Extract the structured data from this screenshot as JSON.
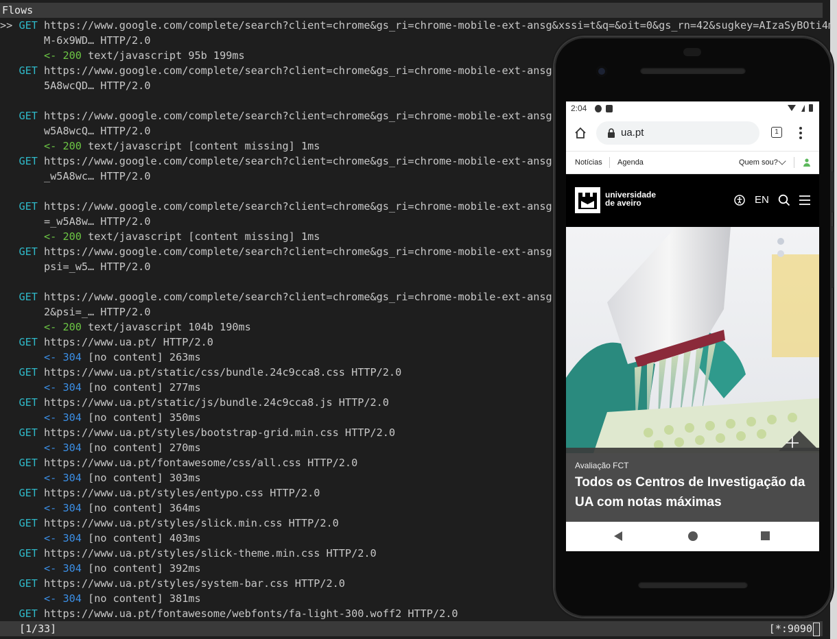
{
  "terminal": {
    "title": "Flows",
    "status_left": "[1/33]",
    "status_right": "[*:9090",
    "selection_marker": ">>",
    "flows": [
      {
        "req_line": "https://www.google.com/complete/search?client=chrome&gs_ri=chrome-mobile-ext-ansg&xssi=t&q=&oit=0&gs_rn=42&sugkey=AIzaSyBOti4m",
        "req_cont": "M-6x9WD… HTTP/2.0",
        "method": "GET",
        "resp": {
          "arrow": "<-",
          "code": "200",
          "text": "text/javascript 95b 199ms"
        }
      },
      {
        "req_line": "https://www.google.com/complete/search?client=chrome&gs_ri=chrome-mobile-ext-ansg&x",
        "req_cont": "5A8wcQD… HTTP/2.0",
        "method": "GET"
      },
      {
        "req_line": "https://www.google.com/complete/search?client=chrome&gs_ri=chrome-mobile-ext-ansg&x",
        "req_cont": "w5A8wcQ… HTTP/2.0",
        "method": "GET",
        "resp": {
          "arrow": "<-",
          "code": "200",
          "text": "text/javascript [content missing] 1ms"
        }
      },
      {
        "req_line": "https://www.google.com/complete/search?client=chrome&gs_ri=chrome-mobile-ext-ansg&x",
        "req_cont": "_w5A8wc… HTTP/2.0",
        "method": "GET"
      },
      {
        "req_line": "https://www.google.com/complete/search?client=chrome&gs_ri=chrome-mobile-ext-ansg&x",
        "req_cont": "=_w5A8w… HTTP/2.0",
        "method": "GET",
        "resp": {
          "arrow": "<-",
          "code": "200",
          "text": "text/javascript [content missing] 1ms"
        }
      },
      {
        "req_line": "https://www.google.com/complete/search?client=chrome&gs_ri=chrome-mobile-ext-ansg&x",
        "req_cont": "psi=_w5… HTTP/2.0",
        "method": "GET"
      },
      {
        "req_line": "https://www.google.com/complete/search?client=chrome&gs_ri=chrome-mobile-ext-ansg&x",
        "req_cont": "2&psi=_… HTTP/2.0",
        "method": "GET",
        "resp": {
          "arrow": "<-",
          "code": "200",
          "text": "text/javascript 104b 190ms"
        }
      },
      {
        "req_line": "https://www.ua.pt/ HTTP/2.0",
        "method": "GET",
        "resp": {
          "arrow": "<-",
          "code": "304",
          "text": "[no content] 263ms"
        }
      },
      {
        "req_line": "https://www.ua.pt/static/css/bundle.24c9cca8.css HTTP/2.0",
        "method": "GET",
        "resp": {
          "arrow": "<-",
          "code": "304",
          "text": "[no content] 277ms"
        }
      },
      {
        "req_line": "https://www.ua.pt/static/js/bundle.24c9cca8.js HTTP/2.0",
        "method": "GET",
        "resp": {
          "arrow": "<-",
          "code": "304",
          "text": "[no content] 350ms"
        }
      },
      {
        "req_line": "https://www.ua.pt/styles/bootstrap-grid.min.css HTTP/2.0",
        "method": "GET",
        "resp": {
          "arrow": "<-",
          "code": "304",
          "text": "[no content] 270ms"
        }
      },
      {
        "req_line": "https://www.ua.pt/fontawesome/css/all.css HTTP/2.0",
        "method": "GET",
        "resp": {
          "arrow": "<-",
          "code": "304",
          "text": "[no content] 303ms"
        }
      },
      {
        "req_line": "https://www.ua.pt/styles/entypo.css HTTP/2.0",
        "method": "GET",
        "resp": {
          "arrow": "<-",
          "code": "304",
          "text": "[no content] 364ms"
        }
      },
      {
        "req_line": "https://www.ua.pt/styles/slick.min.css HTTP/2.0",
        "method": "GET",
        "resp": {
          "arrow": "<-",
          "code": "304",
          "text": "[no content] 403ms"
        }
      },
      {
        "req_line": "https://www.ua.pt/styles/slick-theme.min.css HTTP/2.0",
        "method": "GET",
        "resp": {
          "arrow": "<-",
          "code": "304",
          "text": "[no content] 392ms"
        }
      },
      {
        "req_line": "https://www.ua.pt/styles/system-bar.css HTTP/2.0",
        "method": "GET",
        "resp": {
          "arrow": "<-",
          "code": "304",
          "text": "[no content] 381ms"
        }
      },
      {
        "req_line": "https://www.ua.pt/fontawesome/webfonts/fa-light-300.woff2 HTTP/2.0",
        "method": "GET"
      }
    ]
  },
  "phone": {
    "status_time": "2:04",
    "address": "ua.pt",
    "tab_count": "1",
    "topnav": {
      "noticias": "Notícias",
      "agenda": "Agenda",
      "quem_sou": "Quem sou?"
    },
    "logo_line1": "universidade",
    "logo_line2": "de aveiro",
    "lang": "EN",
    "hero_category": "Avaliação FCT",
    "hero_title": "Todos os Centros de Investigação da UA com notas máximas"
  },
  "colors": {
    "method": "#2fb8c8",
    "code_200": "#6cc644",
    "code_304": "#3b8fe6",
    "terminal_bg": "#1e1e1e",
    "bar_bg": "#3a3a3a",
    "ua_header_bg": "#000000",
    "user_green": "#5cb85c"
  }
}
